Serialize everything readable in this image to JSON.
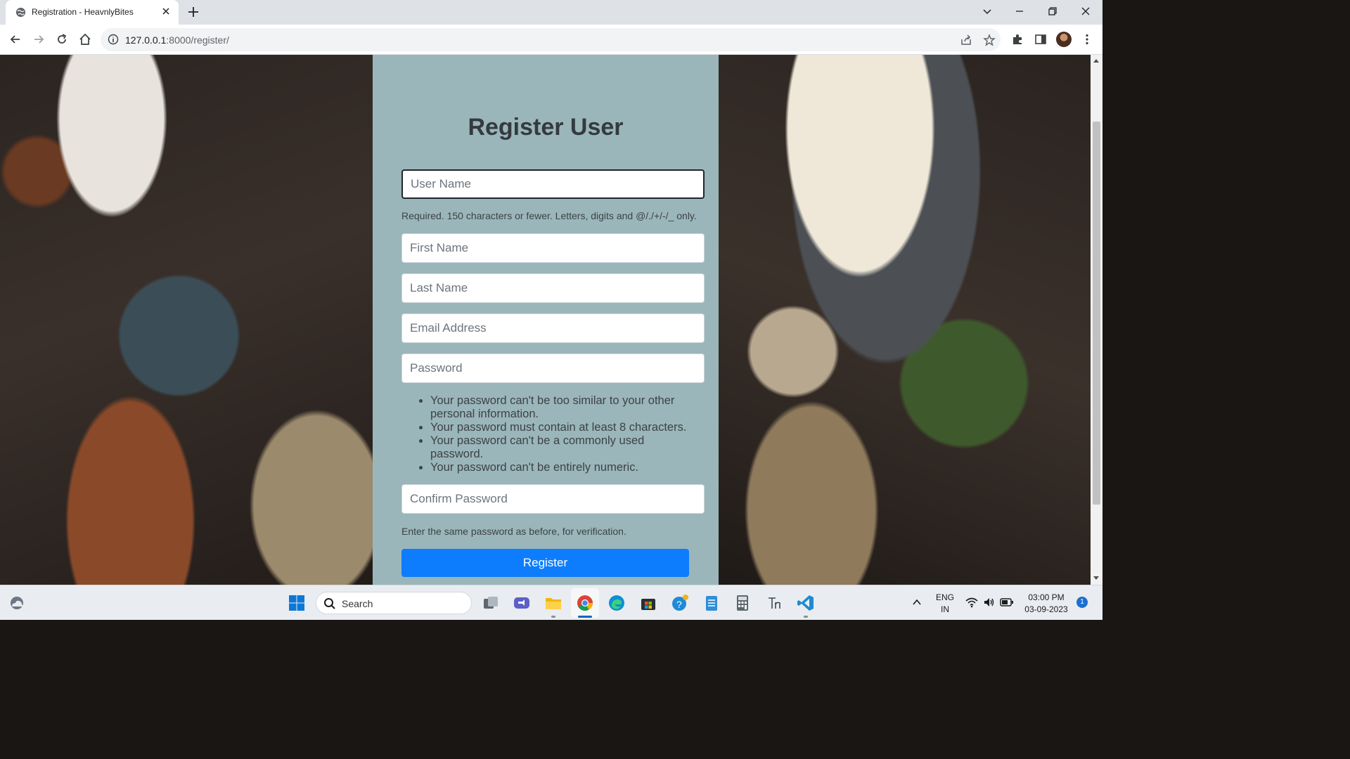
{
  "browser": {
    "tab_title": "Registration - HeavnlyBites",
    "url_host": "127.0.0.1",
    "url_path": ":8000/register/"
  },
  "form": {
    "title": "Register User",
    "username_placeholder": "User Name",
    "username_help": "Required. 150 characters or fewer. Letters, digits and @/./+/-/_ only.",
    "first_name_placeholder": "First Name",
    "last_name_placeholder": "Last Name",
    "email_placeholder": "Email Address",
    "password_placeholder": "Password",
    "password_rules": [
      "Your password can't be too similar to your other personal information.",
      "Your password must contain at least 8 characters.",
      "Your password can't be a commonly used password.",
      "Your password can't be entirely numeric."
    ],
    "confirm_password_placeholder": "Confirm Password",
    "confirm_help": "Enter the same password as before, for verification.",
    "register_label": "Register",
    "button_color": "#0d7dfd",
    "panel_color": "#9ab6ba"
  },
  "taskbar": {
    "search_label": "Search",
    "language_line1": "ENG",
    "language_line2": "IN",
    "time": "03:00 PM",
    "date": "03-09-2023",
    "notification_count": "1"
  }
}
